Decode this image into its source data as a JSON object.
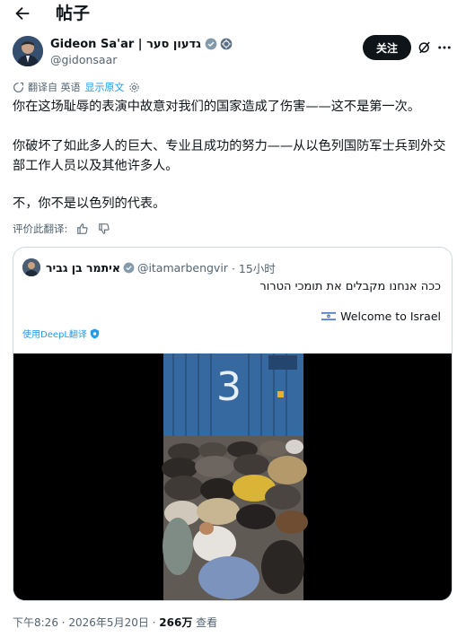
{
  "header": {
    "title": "帖子"
  },
  "author": {
    "display_name": "Gideon Sa'ar | גדעון סער",
    "handle": "@gidonsaar"
  },
  "actions": {
    "follow_label": "关注"
  },
  "translation": {
    "label": "翻译自 英语",
    "show_original": "显示原文"
  },
  "tweet": {
    "paragraphs": [
      "你在这场耻辱的表演中故意对我们的国家造成了伤害——这不是第一次。",
      "你破坏了如此多人的巨大、专业且成功的努力——从以色列国防军士兵到外交部工作人员以及其他许多人。",
      "不，你不是以色列的代表。"
    ]
  },
  "rate": {
    "label": "评价此翻译:"
  },
  "quote": {
    "name": "איתמר בן גביר",
    "handle": "@itamarbengvir",
    "time": "· 15小时",
    "text_he": "ככה אנחנו מקבלים את תומכי הטרור",
    "text_en": "Welcome to Israel",
    "deepl_label": "使用DeepL翻译",
    "video_number": "3"
  },
  "footer": {
    "time": "下午8:26 · 2026年5月20日 · ",
    "views": "266万",
    "views_suffix": " 查看"
  },
  "colors": {
    "accent": "#1d9bf0",
    "text": "#0f1419",
    "muted": "#536471",
    "border": "#cfd9de"
  }
}
